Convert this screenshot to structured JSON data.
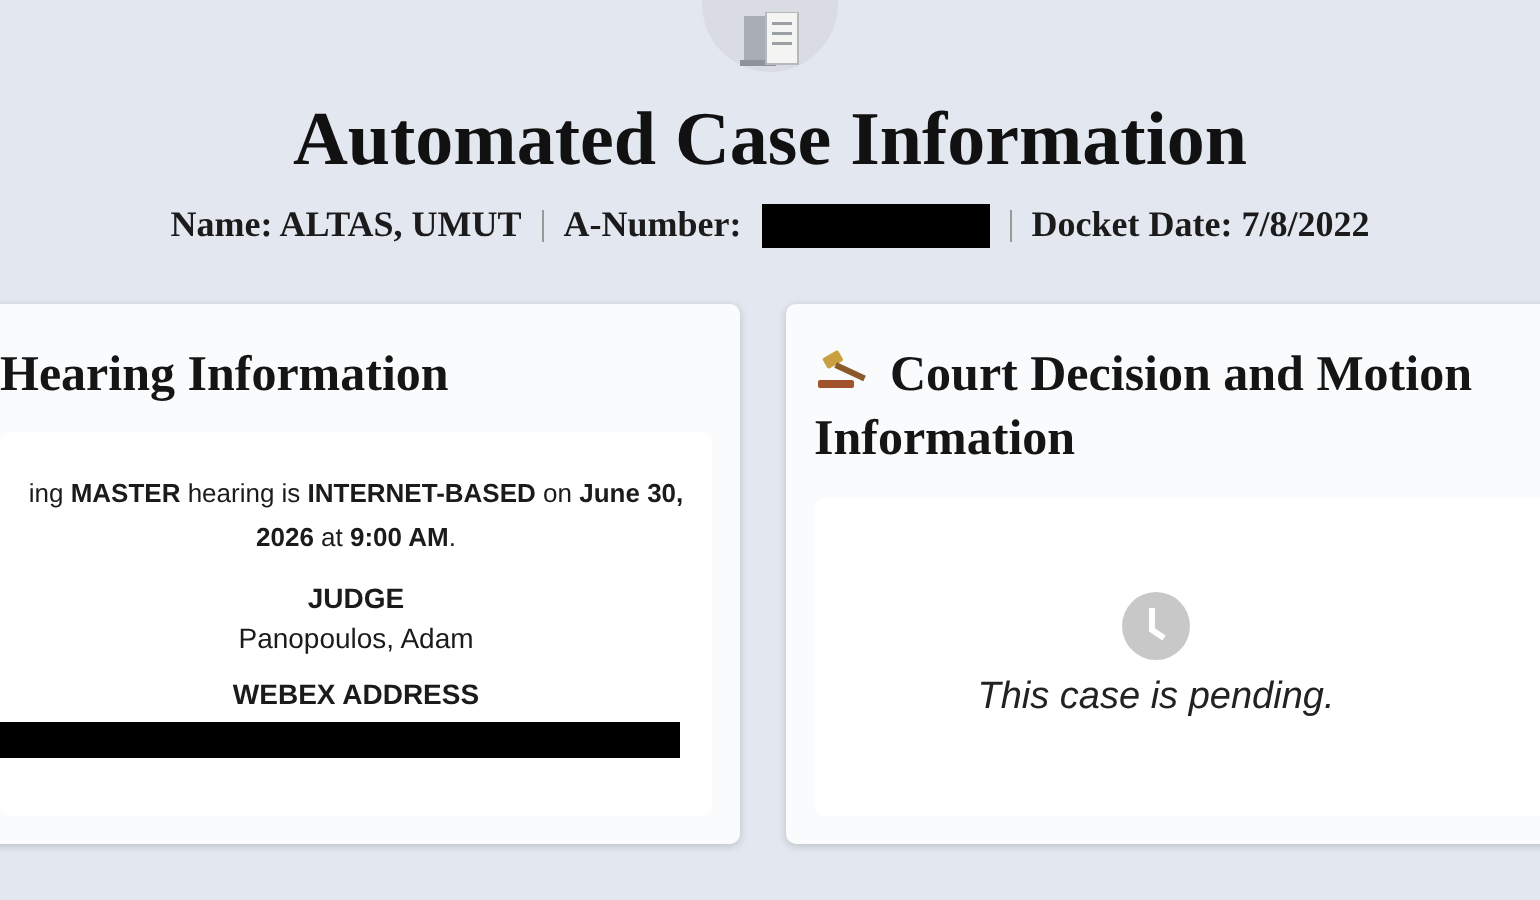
{
  "header": {
    "title": "Automated Case Information",
    "name_label": "Name: ALTAS, UMUT",
    "a_number_label": "A-Number:",
    "a_number_redacted": true,
    "docket_label": "Docket Date: 7/8/2022"
  },
  "hearing": {
    "title": "Hearing Information",
    "sentence": "ing **MASTER** hearing is **INTERNET-BASED** on **June 30, 2026** at **9:00 AM**.",
    "judge_label": "JUDGE",
    "judge": "Panopoulos, Adam",
    "webex_label": "WEBEX ADDRESS",
    "webex_redacted": true
  },
  "decision": {
    "title": "Court Decision and Motion Information",
    "status": "This case is pending."
  }
}
